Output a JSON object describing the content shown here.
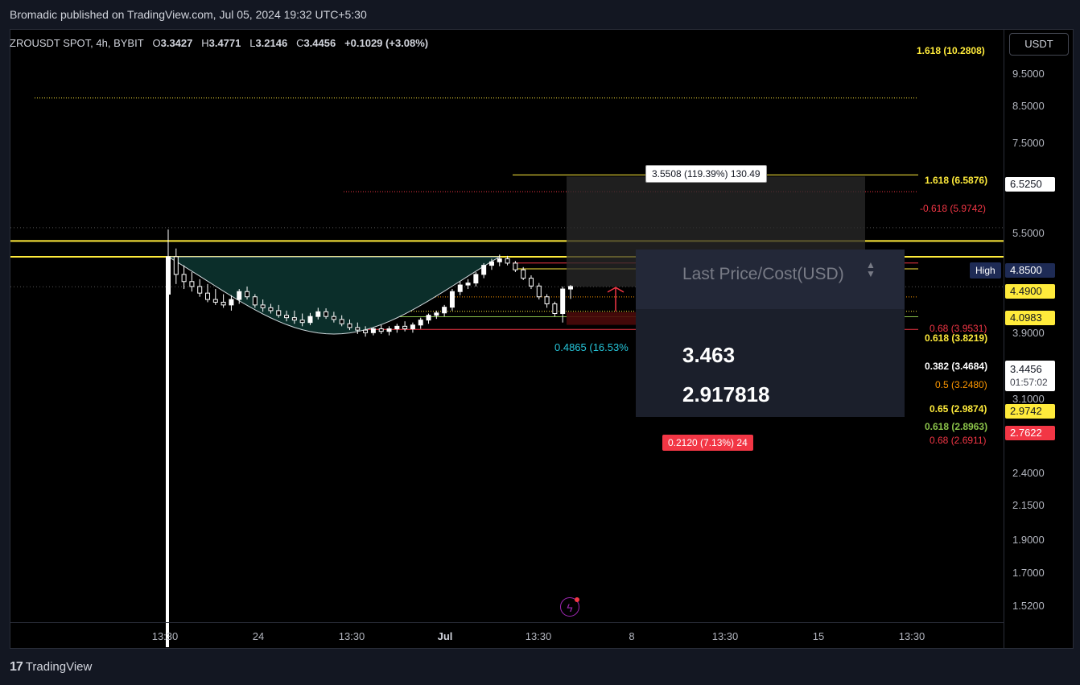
{
  "header": {
    "publisher_text": "Bromadic published on TradingView.com, Jul 05, 2024 19:32 UTC+5:30"
  },
  "legend": {
    "symbol": "ZROUSDT SPOT, 4h, BYBIT",
    "open_label": "O",
    "open": "3.3427",
    "high_label": "H",
    "high": "3.4771",
    "low_label": "L",
    "low": "3.2146",
    "close_label": "C",
    "close": "3.4456",
    "change": "+0.1029 (+3.08%)"
  },
  "currency_button": "USDT",
  "price_axis": {
    "ticks": [
      "9.5000",
      "8.5000",
      "7.5000",
      "5.5000",
      "3.9000",
      "3.1000",
      "2.4000",
      "2.1500",
      "1.9000",
      "1.7000",
      "1.5200"
    ],
    "labels": {
      "p6525": "6.5250",
      "high_tag": "High",
      "high_value": "4.8500",
      "p4490": "4.4900",
      "p4098": "4.0983",
      "current": "3.4456",
      "countdown": "01:57:02",
      "p2974": "2.9742",
      "p2762": "2.7622"
    }
  },
  "time_axis": {
    "ticks": [
      "13:30",
      "24",
      "13:30",
      "Jul",
      "13:30",
      "8",
      "13:30",
      "15",
      "13:30"
    ]
  },
  "fib_labels": {
    "top": "1.618 (10.2808)",
    "f6587": "1.618 (6.5876)",
    "f5974": "-0.618 (5.9742)",
    "f3953": "0.68 (3.9531)",
    "f3821": "0.618 (3.8219)",
    "f3468": "0.382 (3.4684)",
    "f3248": "0.5 (3.2480)",
    "f2987": "0.65 (2.9874)",
    "f2896": "0.618 (2.8963)",
    "f2691": "0.68 (2.6911)"
  },
  "position_tool": {
    "target_label": "3.5508 (119.39%) 130.49",
    "stop_label": "0.2120 (7.13%) 24",
    "midline_label": "0.4865 (16.53%"
  },
  "popup": {
    "header": "Last Price/Cost(USD)",
    "price": "3.463",
    "cost": "2.917818"
  },
  "footer": {
    "brand": "TradingView"
  },
  "colors": {
    "up": "#ffffff",
    "down": "#ffffff",
    "fib_yellow": "#ffeb3b",
    "fib_red": "#f23645",
    "cup_fill": "#0b2e2a",
    "target_zone": "#2a2a2a",
    "stop_zone": "#4a0a0a"
  },
  "chart_data": {
    "type": "candlestick",
    "interval": "4h",
    "y_scale": "log",
    "ylim": [
      1.45,
      10.9
    ],
    "candles": [
      [
        3.3,
        4.8,
        3.2,
        4.1
      ],
      [
        4.1,
        4.3,
        3.5,
        3.7
      ],
      [
        3.7,
        3.9,
        3.4,
        3.55
      ],
      [
        3.55,
        3.75,
        3.35,
        3.45
      ],
      [
        3.45,
        3.6,
        3.25,
        3.32
      ],
      [
        3.32,
        3.5,
        3.15,
        3.2
      ],
      [
        3.2,
        3.4,
        3.1,
        3.15
      ],
      [
        3.15,
        3.3,
        3.05,
        3.1
      ],
      [
        3.1,
        3.28,
        3.0,
        3.2
      ],
      [
        3.2,
        3.4,
        3.12,
        3.35
      ],
      [
        3.35,
        3.45,
        3.2,
        3.25
      ],
      [
        3.25,
        3.3,
        3.05,
        3.1
      ],
      [
        3.1,
        3.2,
        2.98,
        3.05
      ],
      [
        3.05,
        3.12,
        2.95,
        3.0
      ],
      [
        3.0,
        3.1,
        2.88,
        2.92
      ],
      [
        2.92,
        3.0,
        2.82,
        2.88
      ],
      [
        2.88,
        3.0,
        2.78,
        2.84
      ],
      [
        2.84,
        2.95,
        2.74,
        2.8
      ],
      [
        2.8,
        2.96,
        2.76,
        2.9
      ],
      [
        2.9,
        3.05,
        2.85,
        2.98
      ],
      [
        2.98,
        3.04,
        2.86,
        2.9
      ],
      [
        2.9,
        2.98,
        2.8,
        2.85
      ],
      [
        2.85,
        2.92,
        2.74,
        2.78
      ],
      [
        2.78,
        2.85,
        2.68,
        2.72
      ],
      [
        2.72,
        2.8,
        2.62,
        2.68
      ],
      [
        2.68,
        2.74,
        2.58,
        2.64
      ],
      [
        2.64,
        2.72,
        2.6,
        2.7
      ],
      [
        2.7,
        2.76,
        2.62,
        2.66
      ],
      [
        2.66,
        2.74,
        2.6,
        2.7
      ],
      [
        2.7,
        2.78,
        2.64,
        2.74
      ],
      [
        2.74,
        2.82,
        2.66,
        2.7
      ],
      [
        2.7,
        2.8,
        2.64,
        2.76
      ],
      [
        2.76,
        2.88,
        2.7,
        2.84
      ],
      [
        2.84,
        2.95,
        2.78,
        2.92
      ],
      [
        2.92,
        3.0,
        2.86,
        2.96
      ],
      [
        2.96,
        3.1,
        2.9,
        3.06
      ],
      [
        3.06,
        3.4,
        3.0,
        3.35
      ],
      [
        3.35,
        3.55,
        3.28,
        3.48
      ],
      [
        3.48,
        3.6,
        3.4,
        3.52
      ],
      [
        3.52,
        3.75,
        3.45,
        3.7
      ],
      [
        3.7,
        3.95,
        3.62,
        3.9
      ],
      [
        3.9,
        4.05,
        3.8,
        3.98
      ],
      [
        3.98,
        4.15,
        3.88,
        4.05
      ],
      [
        4.05,
        4.12,
        3.9,
        3.95
      ],
      [
        3.95,
        4.0,
        3.75,
        3.8
      ],
      [
        3.8,
        3.86,
        3.58,
        3.62
      ],
      [
        3.62,
        3.68,
        3.4,
        3.46
      ],
      [
        3.46,
        3.52,
        3.2,
        3.25
      ],
      [
        3.25,
        3.3,
        3.05,
        3.12
      ],
      [
        3.12,
        3.16,
        2.9,
        2.95
      ],
      [
        2.95,
        3.45,
        2.8,
        3.4
      ],
      [
        3.4,
        3.48,
        3.21,
        3.45
      ]
    ]
  }
}
